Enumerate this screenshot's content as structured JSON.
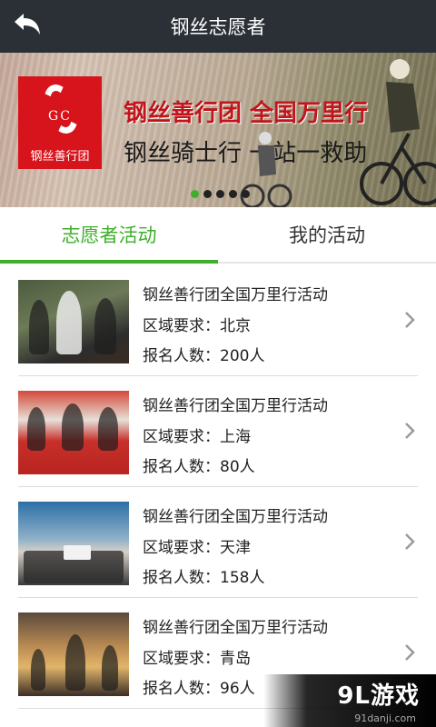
{
  "header": {
    "title": "钢丝志愿者",
    "back_icon": "back-arrow-icon"
  },
  "banner": {
    "logo_letters": "GC",
    "logo_caption": "钢丝善行团",
    "headline": "钢丝善行团 全国万里行",
    "subline": "钢丝骑士行 一站一救助",
    "dots_total": 5,
    "dots_active": 0
  },
  "tabs": [
    {
      "label": "志愿者活动",
      "selected": true
    },
    {
      "label": "我的活动",
      "selected": false
    }
  ],
  "activities": [
    {
      "name": "钢丝善行团全国万里行活动",
      "region": "区域要求：北京",
      "count": "报名人数：200人"
    },
    {
      "name": "钢丝善行团全国万里行活动",
      "region": "区域要求：上海",
      "count": "报名人数：80人"
    },
    {
      "name": "钢丝善行团全国万里行活动",
      "region": "区域要求：天津",
      "count": "报名人数：158人"
    },
    {
      "name": "钢丝善行团全国万里行活动",
      "region": "区域要求：青岛",
      "count": "报名人数：96人"
    }
  ],
  "watermark": {
    "title": "9L游戏",
    "url": "91danji.com"
  },
  "colors": {
    "accent": "#3fae2a",
    "titlebar": "#2b3037",
    "logo_red": "#d7141c"
  }
}
